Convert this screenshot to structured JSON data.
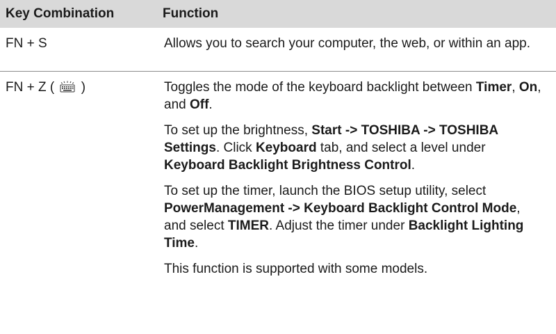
{
  "headers": {
    "key_combination": "Key Combination",
    "function": "Function"
  },
  "rows": [
    {
      "key": "FN + S",
      "function_text": "Allows you to search your computer, the web, or within an app."
    },
    {
      "key_prefix": "FN + Z (",
      "key_icon": "keyboard-backlight-icon",
      "key_suffix": ")",
      "paragraphs": [
        {
          "t1": "Toggles the mode of the keyboard backlight between ",
          "b1": "Timer",
          "t2": ", ",
          "b2": "On",
          "t3": ", and ",
          "b3": "Off",
          "t4": "."
        },
        {
          "t1": "To set up the brightness, ",
          "b1": "Start -> TOSHIBA -> TOSHIBA Settings",
          "t2": ". Click ",
          "b2": "Keyboard",
          "t3": " tab, and select a level under ",
          "b3": "Keyboard Backlight Brightness Control",
          "t4": "."
        },
        {
          "t1": "To set up the timer, launch the BIOS setup utility, select ",
          "b1": "PowerManagement -> Keyboard Backlight Control Mode",
          "t2": ", and select ",
          "b2": "TIMER",
          "t3": ". Adjust the timer under ",
          "b3": "Backlight Lighting Time",
          "t4": "."
        },
        {
          "t1": "This function is supported with some models."
        }
      ]
    }
  ]
}
